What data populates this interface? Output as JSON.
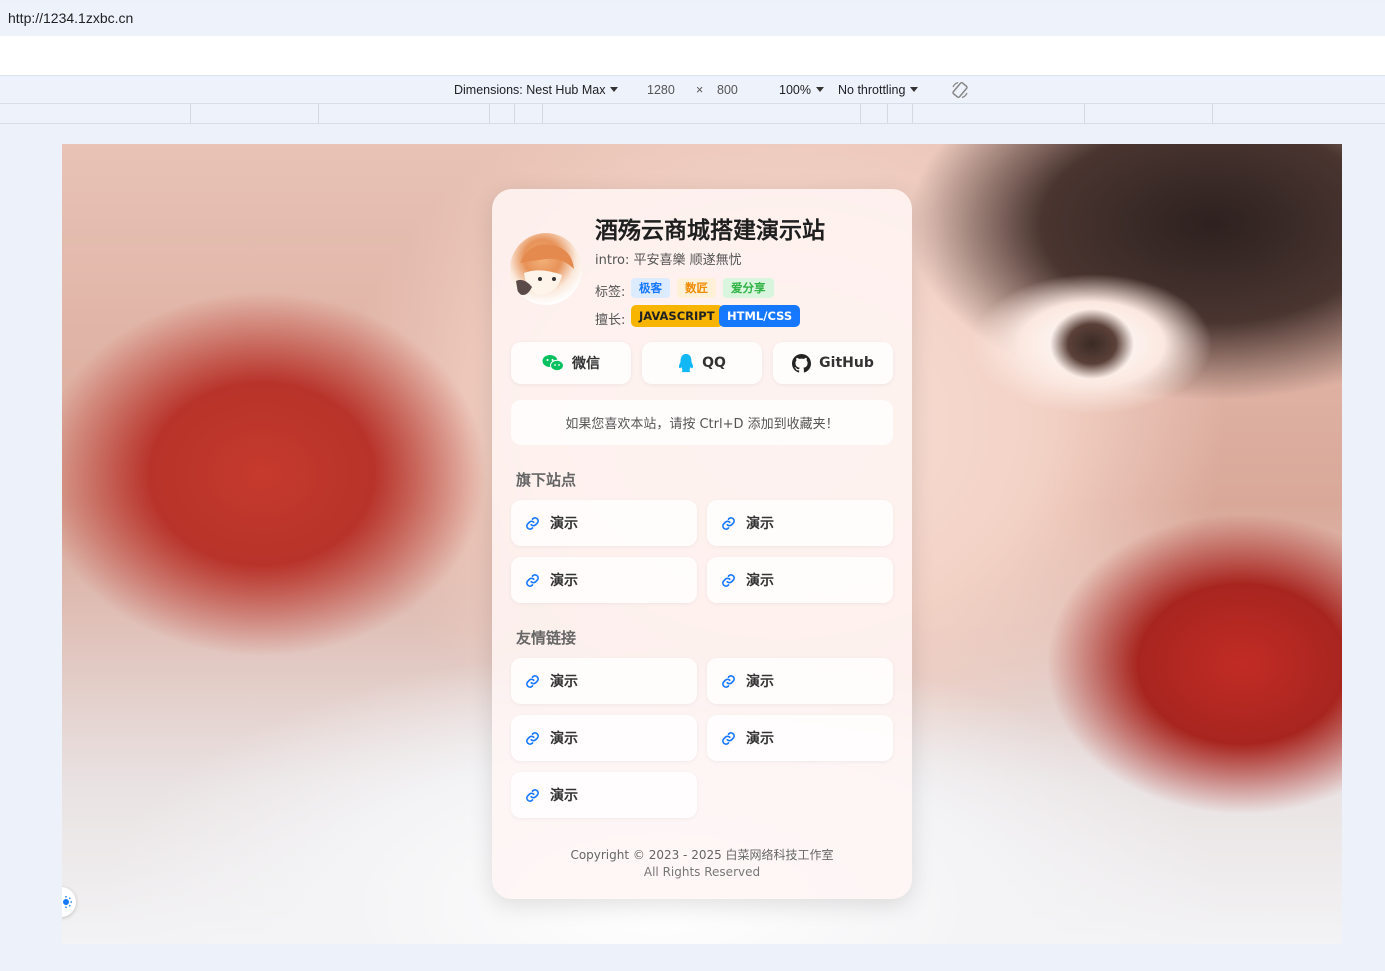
{
  "browser": {
    "url": "http://1234.1zxbc.cn",
    "device_toolbar": {
      "dimensions_label": "Dimensions: Nest Hub Max",
      "width": "1280",
      "times": "×",
      "height": "800",
      "zoom": "100%",
      "throttling": "No throttling"
    }
  },
  "profile": {
    "title": "酒殇云商城搭建演示站",
    "intro": "intro: 平安喜樂 顺遂無忧",
    "tags_label": "标签:",
    "tags": [
      {
        "label": "极客",
        "color": "#1677ff",
        "bg": "#dcebff"
      },
      {
        "label": "数匠",
        "color": "#f08c00",
        "bg": "#fff0d8"
      },
      {
        "label": "爱分享",
        "color": "#2fb344",
        "bg": "#daf5de"
      }
    ],
    "skills_label": "擅长:",
    "skills": [
      {
        "label": "JAVASCRIPT",
        "color": "#222222",
        "bg": "#f7b500"
      },
      {
        "label": "HTML/CSS",
        "color": "#ffffff",
        "bg": "#1677ff"
      }
    ]
  },
  "social": [
    {
      "label": "微信",
      "icon": "wechat-icon"
    },
    {
      "label": "QQ",
      "icon": "qq-icon"
    },
    {
      "label": "GitHub",
      "icon": "github-icon"
    }
  ],
  "notice": "如果您喜欢本站，请按 Ctrl+D 添加到收藏夹！",
  "sites": {
    "title": "旗下站点",
    "items": [
      "演示",
      "演示",
      "演示",
      "演示"
    ]
  },
  "friends": {
    "title": "友情链接",
    "items": [
      "演示",
      "演示",
      "演示",
      "演示",
      "演示"
    ]
  },
  "footer": {
    "copyright": "Copyright © 2023 - 2025 白菜网络科技工作室",
    "rights": "All Rights Reserved"
  },
  "colors": {
    "link_icon": "#1677ff",
    "wechat": "#07c160",
    "qq": "#12b7f5"
  }
}
